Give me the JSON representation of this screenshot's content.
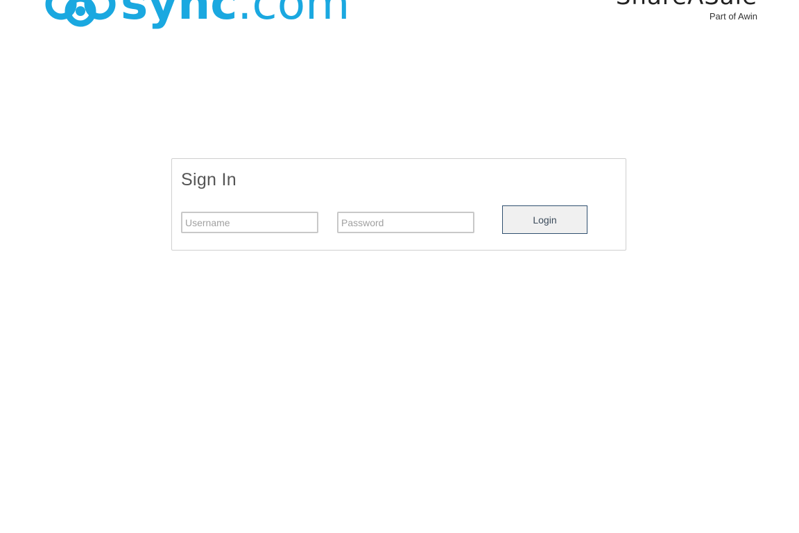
{
  "header": {
    "logo_left": {
      "text_bold": "sync",
      "text_light": ".com",
      "color": "#1aa8e0"
    },
    "logo_right": {
      "name": "ShareASale",
      "sub": "Part of Awin"
    }
  },
  "signin": {
    "title": "Sign In",
    "username": {
      "placeholder": "Username",
      "value": ""
    },
    "password": {
      "placeholder": "Password",
      "value": ""
    },
    "login_label": "Login"
  }
}
